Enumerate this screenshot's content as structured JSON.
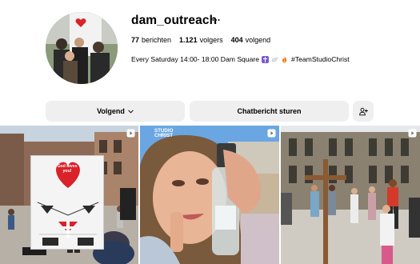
{
  "profile": {
    "username": "dam_outreach",
    "stats": [
      {
        "value": "77",
        "label": "berichten"
      },
      {
        "value": "1.121",
        "label": "volgers"
      },
      {
        "value": "404",
        "label": "volgend"
      }
    ],
    "bio_text": "Every Saturday 14:00- 18:00 Dam Square",
    "bio_emojis": [
      "cross-icon",
      "dove-icon",
      "fire-icon"
    ],
    "bio_hashtag": "#TeamStudioChrist"
  },
  "actions": {
    "follow_label": "Volgend",
    "message_label": "Chatbericht sturen",
    "add_user_icon": "add-user-icon"
  },
  "posts": [
    {
      "type": "reel",
      "sign_text": "God loves you!"
    },
    {
      "type": "reel",
      "overlay_text": "STUDIO CHRIST"
    },
    {
      "type": "reel"
    }
  ],
  "colors": {
    "button_bg": "#efefef",
    "heart_red": "#d9222a",
    "cross_emoji_purple": "#7a5cc9"
  }
}
